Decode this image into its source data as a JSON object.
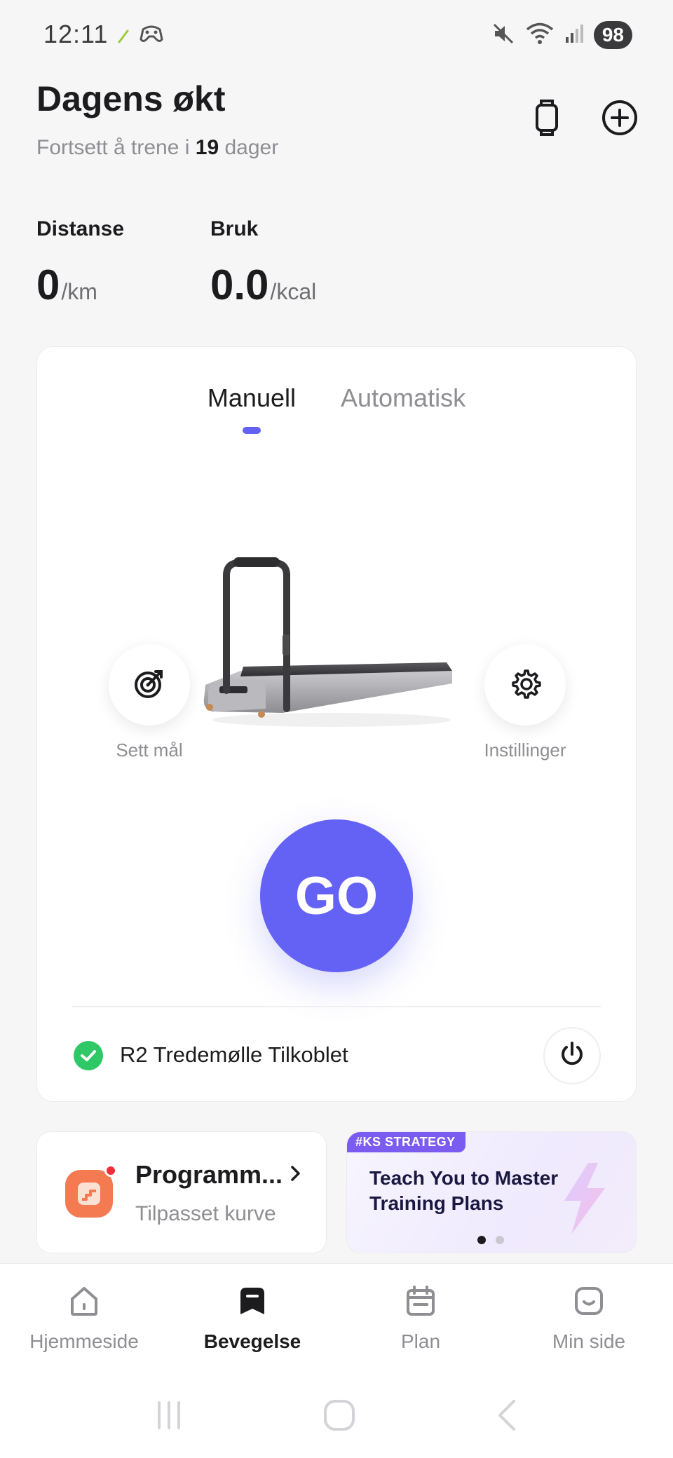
{
  "status_bar": {
    "time": "12:11",
    "battery": "98",
    "icons": [
      "leaf-icon",
      "gamepad-icon",
      "mute-icon",
      "wifi-icon",
      "signal-icon"
    ]
  },
  "header": {
    "title": "Dagens økt",
    "subtitle_prefix": "Fortsett å trene i ",
    "subtitle_days": "19",
    "subtitle_suffix": " dager"
  },
  "stats": {
    "distance": {
      "label": "Distanse",
      "value": "0",
      "unit": "/km"
    },
    "usage": {
      "label": "Bruk",
      "value": "0.0",
      "unit": "/kcal"
    }
  },
  "mode_tabs": [
    {
      "label": "Manuell",
      "active": true
    },
    {
      "label": "Automatisk",
      "active": false
    }
  ],
  "controls": {
    "goal_label": "Sett mål",
    "go_label": "GO",
    "settings_label": "Instillinger"
  },
  "connection": {
    "text": "R2 Tredemølle Tilkoblet"
  },
  "program_card": {
    "title": "Programm...",
    "subtitle": "Tilpasset kurve"
  },
  "banner": {
    "tag": "#KS STRATEGY",
    "title": "Teach You to Master Training Plans",
    "page_count": 2,
    "active_page": 1
  },
  "bottom_nav": [
    {
      "label": "Hjemmeside",
      "icon": "home-icon",
      "active": false
    },
    {
      "label": "Bevegelse",
      "icon": "exercise-icon",
      "active": true
    },
    {
      "label": "Plan",
      "icon": "calendar-icon",
      "active": false
    },
    {
      "label": "Min side",
      "icon": "profile-icon",
      "active": false
    }
  ],
  "colors": {
    "accent": "#6462f5",
    "success": "#2ec866",
    "program_icon": "#f47a52",
    "notification_dot": "#ef2e3a"
  }
}
